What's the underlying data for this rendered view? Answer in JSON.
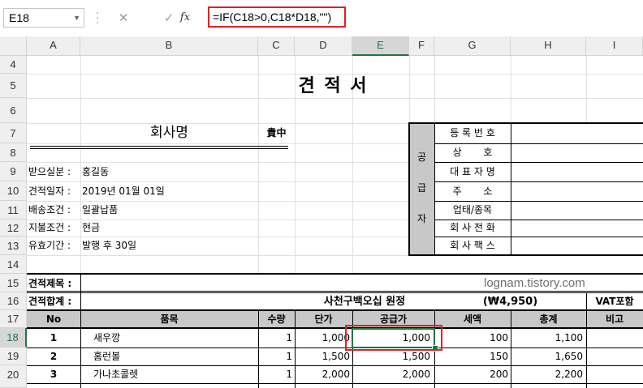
{
  "formula_bar": {
    "name_box": "E18",
    "cancel_icon": "✕",
    "enter_icon": "✓",
    "fx_label": "fx",
    "formula": "=IF(C18>0,C18*D18,\"\")"
  },
  "columns": [
    "A",
    "B",
    "C",
    "D",
    "E",
    "F",
    "G",
    "H",
    "I"
  ],
  "rows": [
    "4",
    "5",
    "6",
    "7",
    "8",
    "9",
    "10",
    "11",
    "12",
    "13",
    "14",
    "15",
    "16",
    "17",
    "18",
    "19",
    "20"
  ],
  "selected_cell": "E18",
  "quote": {
    "title": "견 적 서",
    "company_label": "회사명",
    "company_suffix": "貴中",
    "info": [
      {
        "label": "받으실분 :",
        "value": "홍길동"
      },
      {
        "label": "견적일자 :",
        "value": "2019년 01월 01일"
      },
      {
        "label": "배송조건 :",
        "value": "일괄납품"
      },
      {
        "label": "지불조건 :",
        "value": "현금"
      },
      {
        "label": "유효기간 :",
        "value": "발행 후 30일"
      }
    ],
    "supplier_vertical": [
      "공",
      "급",
      "자"
    ],
    "supplier_fields": [
      "등 록 번 호",
      "상       호",
      "대 표 자 명",
      "주       소",
      "업태/종목",
      "회 사 전 화",
      "회 사 팩 스"
    ],
    "subject_label": "견적제목 :",
    "total_label": "견적합계 :",
    "total_korean": "사천구백오십 원정",
    "total_amount": "(₩4,950)",
    "vat_note": "VAT포함",
    "watermark": "lognam.tistory.com",
    "table_headers": [
      "No",
      "품목",
      "수량",
      "단가",
      "공급가",
      "세액",
      "총계",
      "비고"
    ],
    "items": [
      {
        "no": "1",
        "name": "새우깡",
        "qty": "1",
        "price": "1,000",
        "supply": "1,000",
        "tax": "100",
        "total": "1,100"
      },
      {
        "no": "2",
        "name": "홈런볼",
        "qty": "1",
        "price": "1,500",
        "supply": "1,500",
        "tax": "150",
        "total": "1,650"
      },
      {
        "no": "3",
        "name": "가나초콜렛",
        "qty": "1",
        "price": "2,000",
        "supply": "2,000",
        "tax": "200",
        "total": "2,200"
      }
    ]
  }
}
